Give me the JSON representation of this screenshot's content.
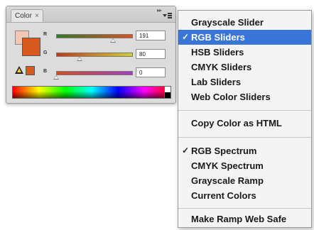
{
  "panel": {
    "tab_label": "Color",
    "tab_close": "×",
    "collapse_glyph": "▸▸",
    "icons": {
      "close": "close-icon",
      "menu": "panel-menu-icon",
      "warning": "out-of-gamut-warning-icon"
    },
    "foreground_color": "#d9581e",
    "background_color": "#f2c7b4",
    "sliders": [
      {
        "channel": "R",
        "value": "191",
        "level": 0.75
      },
      {
        "channel": "G",
        "value": "80",
        "level": 0.31
      },
      {
        "channel": "B",
        "value": "0",
        "level": 0.0
      }
    ]
  },
  "menu": {
    "selection_color": "#3875d7",
    "check_glyph": "✓",
    "items": [
      {
        "label": "Grayscale Slider",
        "checked": false,
        "selected": false
      },
      {
        "label": "RGB Sliders",
        "checked": true,
        "selected": true
      },
      {
        "label": "HSB Sliders",
        "checked": false,
        "selected": false
      },
      {
        "label": "CMYK Sliders",
        "checked": false,
        "selected": false
      },
      {
        "label": "Lab Sliders",
        "checked": false,
        "selected": false
      },
      {
        "label": "Web Color Sliders",
        "checked": false,
        "selected": false
      },
      {
        "label": "Copy Color as HTML",
        "checked": false,
        "selected": false
      },
      {
        "label": "RGB Spectrum",
        "checked": true,
        "selected": false
      },
      {
        "label": "CMYK Spectrum",
        "checked": false,
        "selected": false
      },
      {
        "label": "Grayscale Ramp",
        "checked": false,
        "selected": false
      },
      {
        "label": "Current Colors",
        "checked": false,
        "selected": false
      },
      {
        "label": "Make Ramp Web Safe",
        "checked": false,
        "selected": false
      }
    ]
  }
}
